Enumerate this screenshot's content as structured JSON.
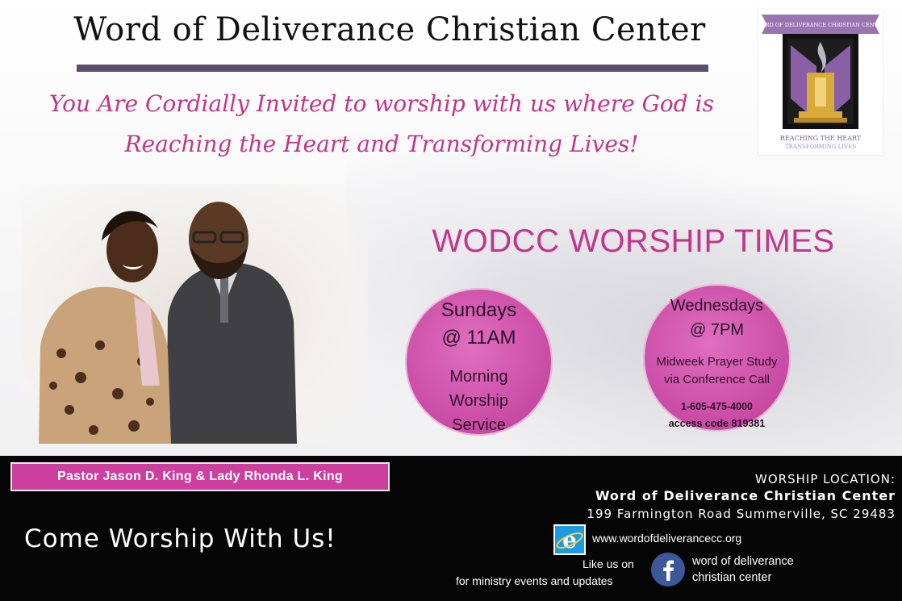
{
  "header": {
    "title": "Word of Deliverance Christian Center",
    "invite_line1": "You Are Cordially Invited to worship with us where God is",
    "invite_line2": "Reaching the Heart and Transforming Lives!"
  },
  "logo": {
    "banner_text": "WORD OF DELIVERANCE CHRISTIAN CENTER",
    "tagline_line1": "REACHING THE HEART",
    "tagline_line2": "TRANSFORMING LIVES"
  },
  "worship_times": {
    "heading": "WODCC WORSHIP TIMES",
    "sunday": {
      "day": "Sundays",
      "time": "@ 11AM",
      "desc_line1": "Morning",
      "desc_line2": "Worship",
      "desc_line3": "Service"
    },
    "wednesday": {
      "day": "Wednesdays",
      "time": "@ 7PM",
      "desc_line1": "Midweek Prayer Study",
      "desc_line2": "via Conference Call",
      "phone": "1-605-475-4000",
      "access_code": "access code 819381"
    }
  },
  "pastors": "Pastor Jason D. King & Lady Rhonda L. King",
  "come_worship": "Come Worship With Us!",
  "location": {
    "label": "WORSHIP LOCATION:",
    "name": "Word of Deliverance Christian Center",
    "address": "199 Farmington Road  Summerville, SC 29483"
  },
  "website": "www.wordofdeliverancecc.org",
  "facebook": {
    "like_text": "Like us on",
    "ministry_text": "for ministry events and updates",
    "page_line1": "word of deliverance",
    "page_line2": "christian center"
  },
  "colors": {
    "accent_pink": "#c2358b",
    "circle_pink": "#cc4fa7",
    "rule_purple": "#5d4f6b",
    "footer_black": "#050505"
  },
  "icons": [
    "internet-explorer-icon",
    "facebook-icon",
    "church-logo"
  ]
}
